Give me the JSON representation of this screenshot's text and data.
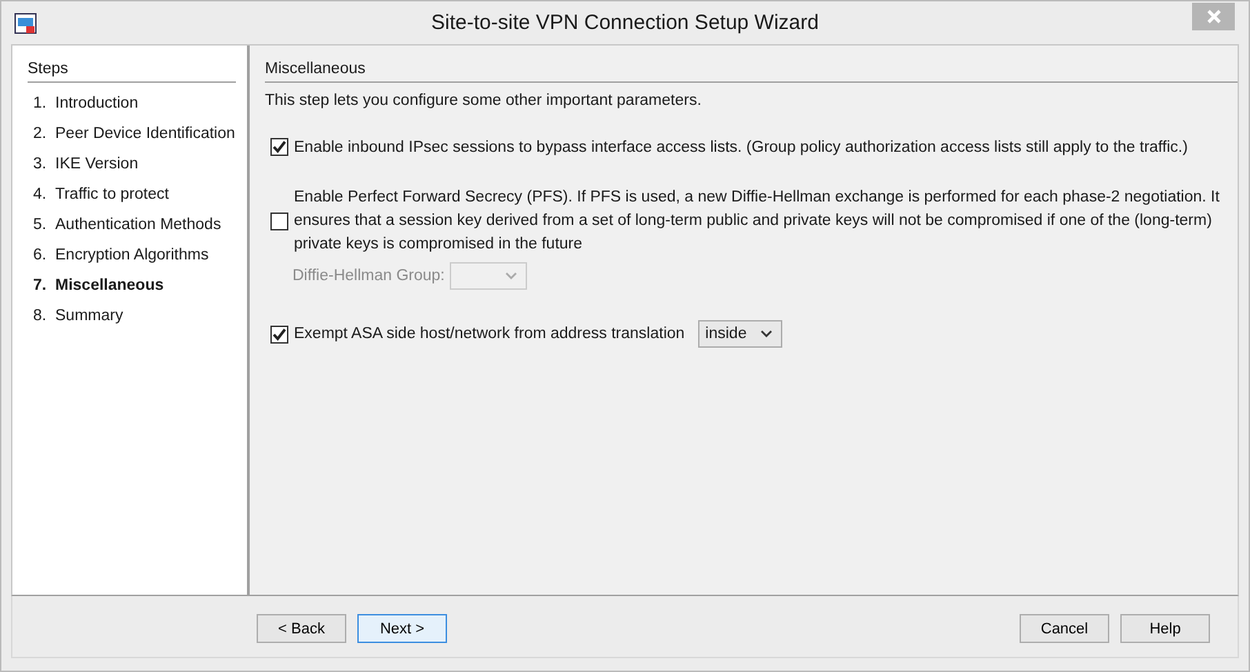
{
  "window": {
    "title": "Site-to-site VPN Connection Setup Wizard"
  },
  "steps": {
    "heading": "Steps",
    "items": [
      {
        "number": "1.",
        "label": "Introduction",
        "selected": false
      },
      {
        "number": "2.",
        "label": "Peer Device Identification",
        "selected": false
      },
      {
        "number": "3.",
        "label": "IKE Version",
        "selected": false
      },
      {
        "number": "4.",
        "label": "Traffic to protect",
        "selected": false
      },
      {
        "number": "5.",
        "label": "Authentication Methods",
        "selected": false
      },
      {
        "number": "6.",
        "label": "Encryption Algorithms",
        "selected": false
      },
      {
        "number": "7.",
        "label": "Miscellaneous",
        "selected": true
      },
      {
        "number": "8.",
        "label": "Summary",
        "selected": false
      }
    ]
  },
  "panel": {
    "heading": "Miscellaneous",
    "intro": "This step lets you configure some other important parameters.",
    "options": [
      {
        "kind": "checkbox",
        "checked": true,
        "label": "Enable inbound IPsec sessions to bypass interface access lists. (Group policy authorization access lists still apply to the traffic.)"
      },
      {
        "kind": "checkbox",
        "checked": false,
        "label": "Enable Perfect Forward Secrecy (PFS). If PFS is used, a new Diffie-Hellman exchange is performed for each phase-2 negotiation. It ensures that a session key derived from a set of long-term public and private keys will not be compromised if one of the (long-term) private keys is compromised in the future"
      },
      {
        "kind": "select",
        "label": "Diffie-Hellman Group:",
        "disabled": true
      },
      {
        "kind": "checkbox-select",
        "checked": true,
        "label": "Exempt ASA side host/network from address translation",
        "value": "inside",
        "disabled": false
      }
    ]
  },
  "buttons": {
    "left": [
      {
        "label": "< Back",
        "focused": false
      },
      {
        "label": "Next >",
        "focused": true
      }
    ],
    "right": [
      {
        "label": "Cancel",
        "focused": false
      },
      {
        "label": "Help",
        "focused": false
      }
    ]
  }
}
